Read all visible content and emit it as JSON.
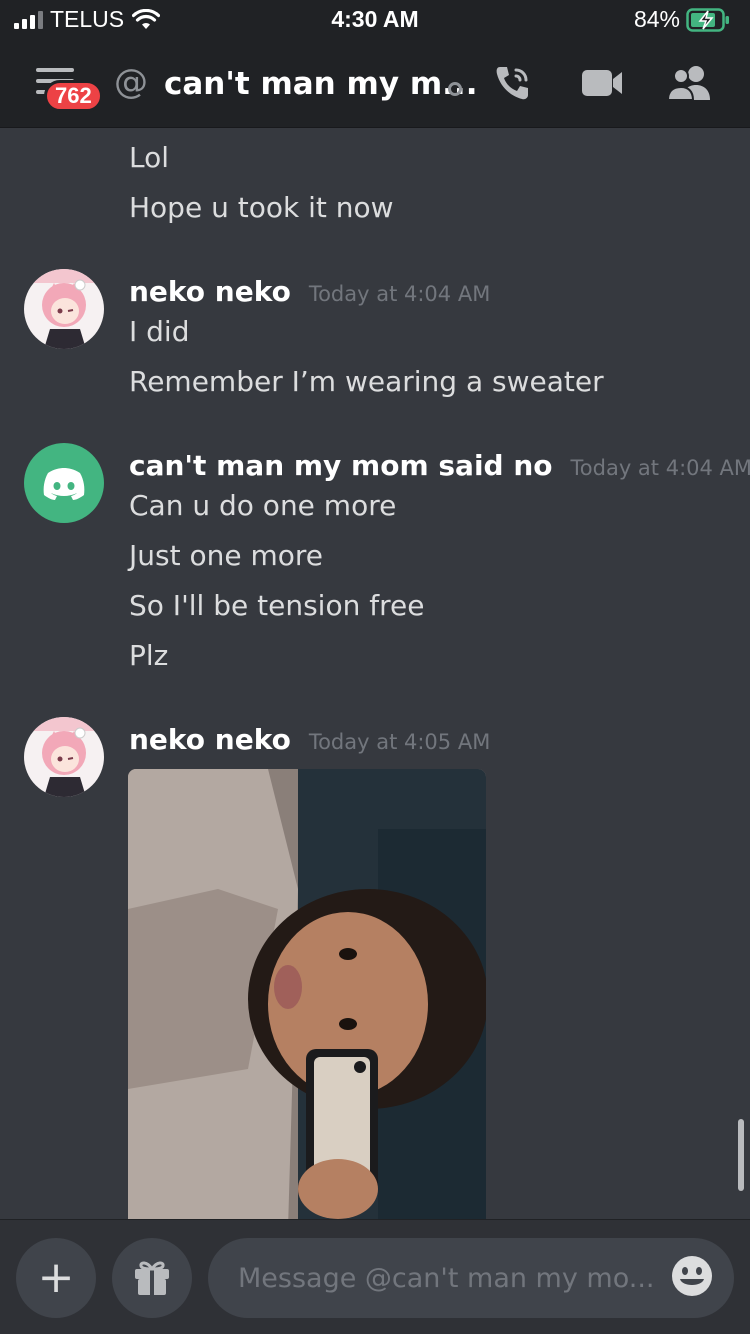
{
  "status_bar": {
    "carrier": "TELUS",
    "time": "4:30 AM",
    "battery": "84%"
  },
  "header": {
    "badge_count": "762",
    "channel_title": "can't man my m..."
  },
  "messages": [
    {
      "lines": [
        "Lol",
        "Hope u took it now"
      ]
    },
    {
      "author": "neko neko",
      "timestamp": "Today at 4:04 AM",
      "lines": [
        "I did",
        "Remember I’m wearing a sweater"
      ]
    },
    {
      "author": "can't man my mom said no",
      "timestamp": "Today at 4:04 AM",
      "lines": [
        "Can u do one more",
        "Just one more",
        "So I'll be tension free",
        "Plz"
      ]
    },
    {
      "author": "neko neko",
      "timestamp": "Today at 4:05 AM",
      "attachment": "image"
    }
  ],
  "composer": {
    "placeholder": "Message @can't man my mo..."
  },
  "icons": {
    "menu": "hamburger-icon",
    "at": "at-icon",
    "call": "phone-call-icon",
    "video": "video-camera-icon",
    "members": "members-icon",
    "add": "plus-icon",
    "gift": "gift-icon",
    "emoji": "emoji-icon"
  },
  "colors": {
    "background": "#36393f",
    "header": "#202225",
    "badge": "#ed4245",
    "discord_avatar": "#43b581",
    "input": "#40444b"
  }
}
